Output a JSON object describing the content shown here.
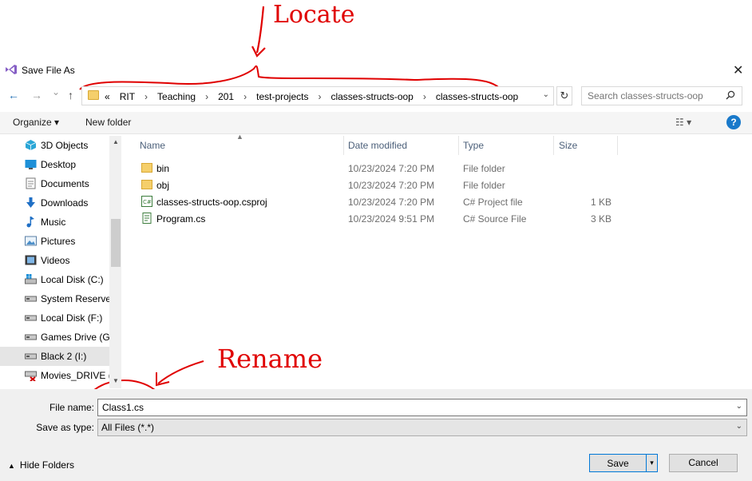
{
  "annotations": {
    "locate": "Locate",
    "rename": "Rename"
  },
  "window": {
    "title": "Save File As",
    "app_icon": "visual-studio-icon",
    "close_glyph": "✕"
  },
  "nav": {
    "back_glyph": "←",
    "forward_glyph": "→",
    "recent_glyph": "⌄",
    "up_glyph": "↑",
    "address_overflow": "«",
    "breadcrumbs": [
      "RIT",
      "Teaching",
      "201",
      "test-projects",
      "classes-structs-oop",
      "classes-structs-oop"
    ],
    "separator": "›",
    "dropdown_glyph": "⌄",
    "refresh_glyph": "↻",
    "search_placeholder": "Search classes-structs-oop"
  },
  "toolbar": {
    "organize": "Organize ▾",
    "new_folder": "New folder",
    "view_glyph": "☷ ▾",
    "help": "?"
  },
  "sidebar": {
    "items": [
      {
        "label": "3D Objects",
        "icon": "3d-objects-icon"
      },
      {
        "label": "Desktop",
        "icon": "desktop-icon"
      },
      {
        "label": "Documents",
        "icon": "documents-icon"
      },
      {
        "label": "Downloads",
        "icon": "downloads-icon"
      },
      {
        "label": "Music",
        "icon": "music-icon"
      },
      {
        "label": "Pictures",
        "icon": "pictures-icon"
      },
      {
        "label": "Videos",
        "icon": "videos-icon"
      },
      {
        "label": "Local Disk (C:)",
        "icon": "windows-drive-icon"
      },
      {
        "label": "System Reserved",
        "icon": "drive-icon"
      },
      {
        "label": "Local Disk (F:)",
        "icon": "drive-icon"
      },
      {
        "label": "Games Drive (G:)",
        "icon": "drive-icon"
      },
      {
        "label": "Black 2 (I:)",
        "icon": "drive-icon",
        "selected": true
      },
      {
        "label": "Movies_DRIVE (\\",
        "icon": "network-drive-disconnected-icon"
      }
    ]
  },
  "files": {
    "columns": [
      "Name",
      "Date modified",
      "Type",
      "Size"
    ],
    "rows": [
      {
        "name": "bin",
        "date": "10/23/2024 7:20 PM",
        "type": "File folder",
        "size": "",
        "icon": "folder-icon"
      },
      {
        "name": "obj",
        "date": "10/23/2024 7:20 PM",
        "type": "File folder",
        "size": "",
        "icon": "folder-icon"
      },
      {
        "name": "classes-structs-oop.csproj",
        "date": "10/23/2024 7:20 PM",
        "type": "C# Project file",
        "size": "1 KB",
        "icon": "csproj-file-icon"
      },
      {
        "name": "Program.cs",
        "date": "10/23/2024 9:51 PM",
        "type": "C# Source File",
        "size": "3 KB",
        "icon": "cs-file-icon"
      }
    ]
  },
  "form": {
    "file_name_label": "File name:",
    "file_name_value": "Class1.cs",
    "save_type_label": "Save as type:",
    "save_type_value": "All Files (*.*)",
    "dropdown_glyph": "⌄"
  },
  "footer": {
    "hide_folders": "Hide Folders",
    "hide_glyph": "▲",
    "save": "Save",
    "save_split_glyph": "▾",
    "cancel": "Cancel"
  },
  "colors": {
    "annotation": "#e00000",
    "accent": "#0078d7",
    "folder": "#f5cf6b"
  }
}
